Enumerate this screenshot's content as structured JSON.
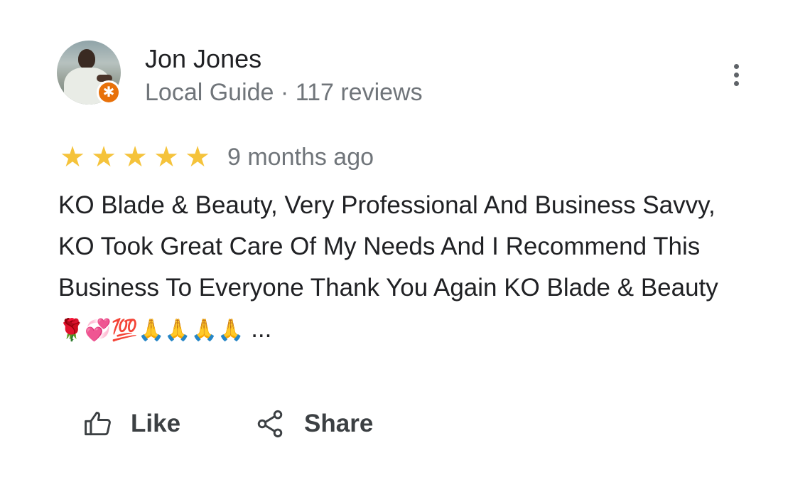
{
  "reviewer": {
    "name": "Jon Jones",
    "role": "Local Guide",
    "separator": "·",
    "review_count": "117 reviews"
  },
  "review": {
    "rating": 5,
    "rating_max": 5,
    "time_ago": "9 months ago",
    "text": "KO Blade & Beauty, Very Professional And Business Savvy, KO Took Great Care Of My Needs And I Recommend This Business To Everyone Thank You Again KO Blade & Beauty",
    "emojis": "🌹💞💯🙏🙏🙏🙏",
    "ellipsis": " ..."
  },
  "actions": {
    "like_label": "Like",
    "share_label": "Share"
  },
  "icons": {
    "more": "more-vert-icon",
    "like": "thumb-up-icon",
    "share": "share-icon",
    "badge": "local-guide-star-icon",
    "star": "star-icon"
  },
  "colors": {
    "star": "#f5c33b",
    "badge": "#e8710a",
    "secondary_text": "#70757a",
    "primary_text": "#202124"
  }
}
